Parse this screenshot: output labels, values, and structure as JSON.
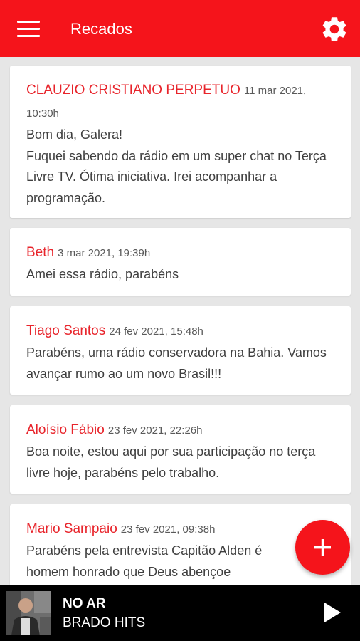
{
  "app_bar": {
    "title": "Recados",
    "background": "#f5141b",
    "menu_icon": "hamburger-menu-icon",
    "settings_icon": "gear-icon"
  },
  "messages": [
    {
      "author": "CLAUZIO CRISTIANO PERPETUO",
      "date": "11 mar 2021, 10:30h",
      "text": "Bom dia, Galera!\nFuquei sabendo da rádio em um super chat no Terça Livre TV. Ótima iniciativa. Irei acompanhar a programação."
    },
    {
      "author": "Beth",
      "date": "3 mar 2021, 19:39h",
      "text": "Amei essa rádio,  parabéns"
    },
    {
      "author": "Tiago Santos",
      "date": "24 fev 2021, 15:48h",
      "text": "Parabéns, uma rádio conservadora na Bahia. Vamos avançar rumo ao um novo Brasil!!!"
    },
    {
      "author": "Aloísio Fábio",
      "date": "23 fev 2021, 22:26h",
      "text": "Boa noite, estou aqui por sua participação no terça livre hoje, parabéns pelo trabalho."
    },
    {
      "author": "Mario Sampaio",
      "date": "23 fev 2021, 09:38h",
      "text": "Parabéns pela entrevista Capitão Alden é homem honrado que Deus abençoe"
    }
  ],
  "fab": {
    "icon": "plus-icon",
    "color": "#f5141b"
  },
  "player": {
    "status": "NO AR",
    "station": "BRADO HITS",
    "play_icon": "play-icon",
    "background": "#000000"
  },
  "colors": {
    "accent": "#f5141b",
    "author": "#e8242b",
    "text": "#3f3f3f",
    "date": "#595959",
    "background": "#e6e6e6"
  }
}
